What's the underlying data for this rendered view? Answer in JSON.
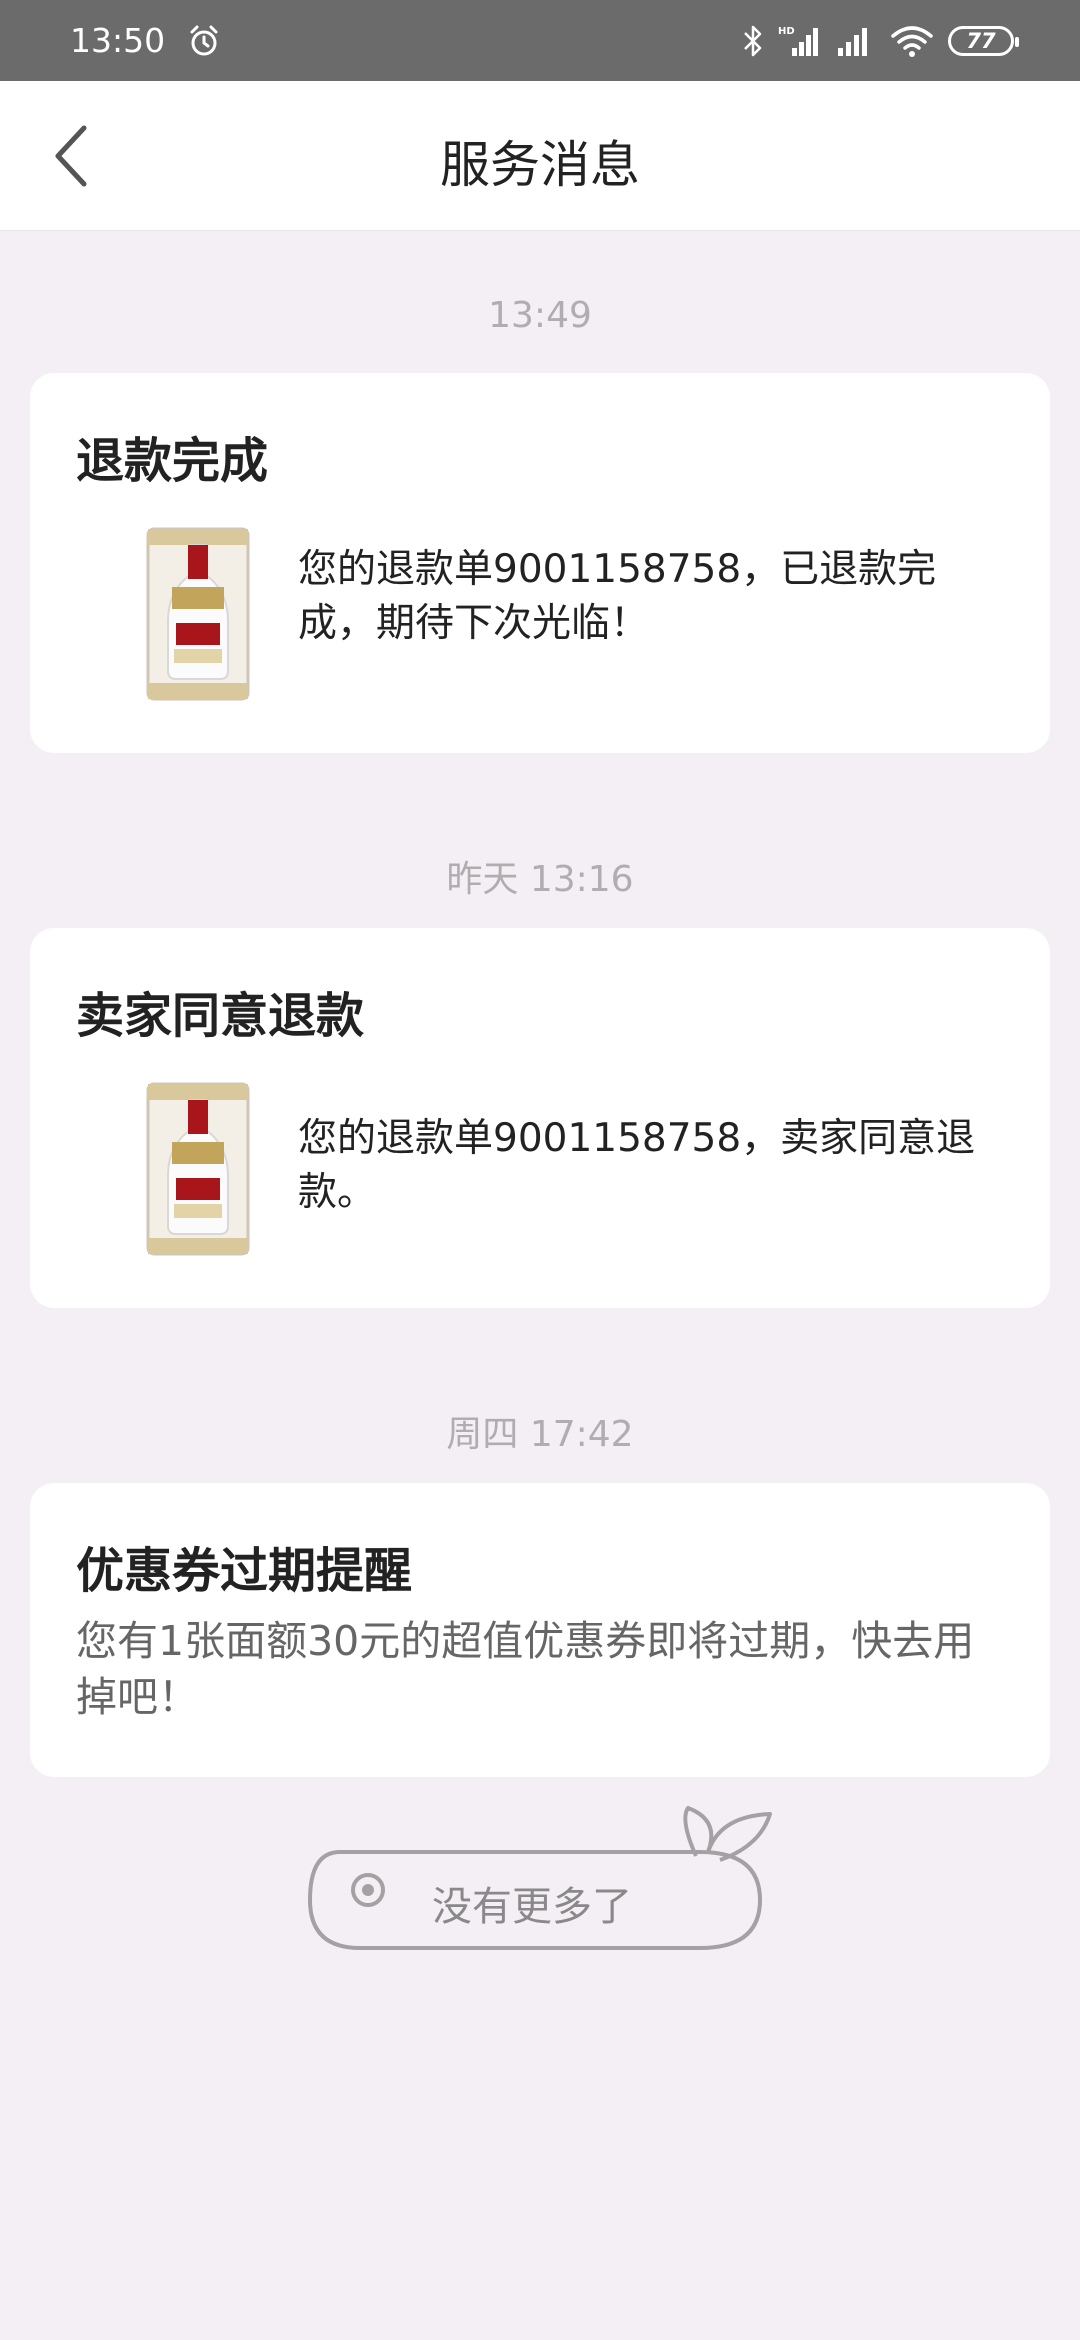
{
  "status_bar": {
    "time": "13:50",
    "battery": "77",
    "icons": [
      "alarm-icon",
      "bluetooth-icon",
      "signal-hd-icon",
      "signal-icon",
      "wifi-icon",
      "battery-icon"
    ]
  },
  "header": {
    "title": "服务消息",
    "back_icon": "chevron-left-icon"
  },
  "messages": [
    {
      "time": "13:49",
      "title": "退款完成",
      "text": "您的退款单9001158758，已退款完成，期待下次光临！",
      "has_image": true
    },
    {
      "time": "昨天 13:16",
      "title": "卖家同意退款",
      "text": "您的退款单9001158758，卖家同意退款。",
      "has_image": true
    },
    {
      "time": "周四 17:42",
      "title": "优惠券过期提醒",
      "text": "您有1张面额30元的超值优惠券即将过期，快去用掉吧！",
      "has_image": false
    }
  ],
  "footer": {
    "end_text": "没有更多了"
  },
  "colors": {
    "background": "#f4eff4",
    "card": "#ffffff",
    "status_bar": "#6b6b6b",
    "timestamp": "#b0adb0",
    "bottle_red": "#a8161b"
  }
}
